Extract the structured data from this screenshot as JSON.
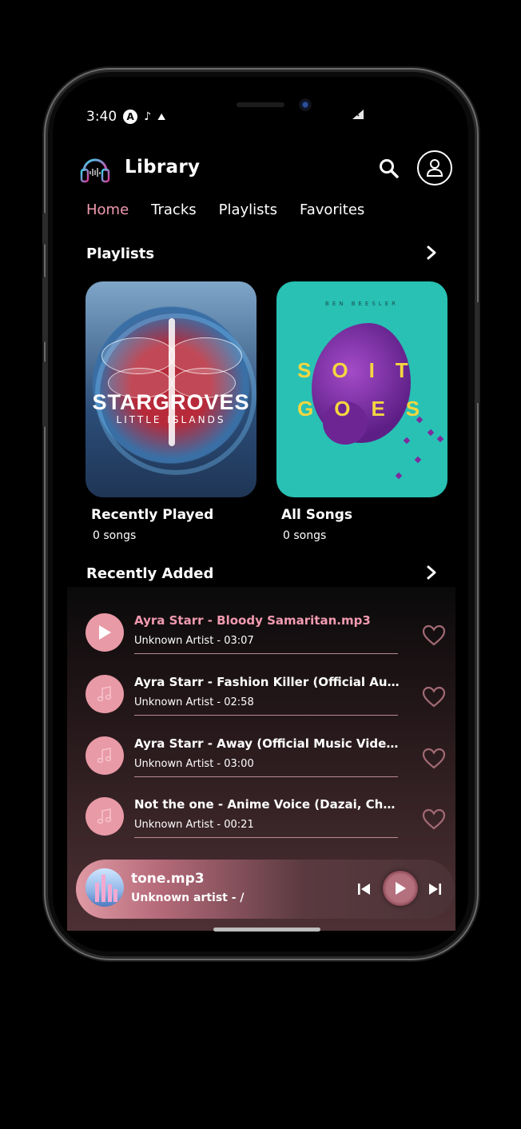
{
  "status_bar": {
    "time": "3:40",
    "a_badge": "A"
  },
  "header": {
    "title": "Library"
  },
  "tabs": [
    {
      "label": "Home",
      "active": true
    },
    {
      "label": "Tracks",
      "active": false
    },
    {
      "label": "Playlists",
      "active": false
    },
    {
      "label": "Favorites",
      "active": false
    }
  ],
  "playlists_section": {
    "title": "Playlists",
    "cards": [
      {
        "title": "Recently Played",
        "count": "0 songs",
        "art_big": "STARGROVES",
        "art_small": "LITTLE ISLANDS"
      },
      {
        "title": "All Songs",
        "count": "0 songs",
        "art_line1": "SOIT",
        "art_line2": "GOES",
        "art_top": "BEN BEESLER"
      }
    ]
  },
  "recent_section": {
    "title": "Recently Added",
    "tracks": [
      {
        "name": "Ayra Starr - Bloody Samaritan.mp3",
        "meta": "Unknown Artist - 03:07",
        "current": true
      },
      {
        "name": "Ayra Starr - Fashion Killer (Official Audi...",
        "meta": "Unknown Artist - 02:58",
        "current": false
      },
      {
        "name": "Ayra Starr - Away (Official Music Video)....",
        "meta": "Unknown Artist - 03:00",
        "current": false
      },
      {
        "name": "Not the one - Anime Voice (Dazai, Chuu...",
        "meta": "Unknown Artist - 00:21",
        "current": false
      }
    ]
  },
  "mini_player": {
    "title": "tone.mp3",
    "subtitle": "Unknown artist -  /"
  },
  "colors": {
    "accent": "#f19ab0",
    "thumb": "#e89aa6",
    "background": "#000000"
  },
  "icons": [
    "headphones-logo-icon",
    "search-icon",
    "profile-icon",
    "chevron-right-icon",
    "play-icon",
    "music-note-icon",
    "heart-icon",
    "skip-previous-icon",
    "skip-next-icon"
  ]
}
